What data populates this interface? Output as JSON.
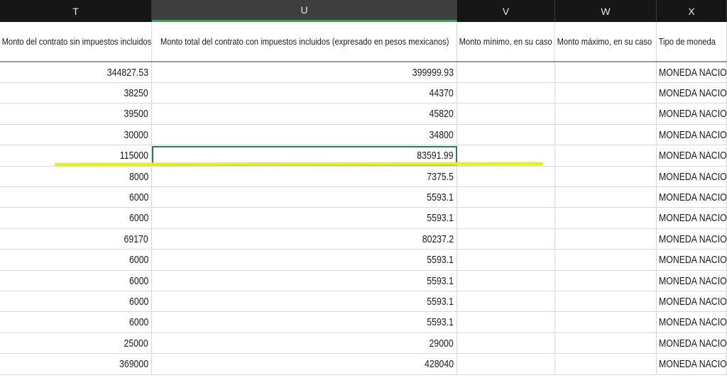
{
  "columns": [
    {
      "letter": "T",
      "header": "Monto del contrato sin impuestos incluidos"
    },
    {
      "letter": "U",
      "header": "Monto total del contrato con impuestos incluidos (expresado en pesos mexicanos)"
    },
    {
      "letter": "V",
      "header": "Monto mínimo, en su caso"
    },
    {
      "letter": "W",
      "header": "Monto máximo, en su caso"
    },
    {
      "letter": "X",
      "header": "Tipo de moneda"
    }
  ],
  "selected_column": "U",
  "rows": [
    [
      "344827.53",
      "399999.93",
      "",
      "",
      "MONEDA NACIOI"
    ],
    [
      "38250",
      "44370",
      "",
      "",
      "MONEDA NACIOI"
    ],
    [
      "39500",
      "45820",
      "",
      "",
      "MONEDA NACIOI"
    ],
    [
      "30000",
      "34800",
      "",
      "",
      "MONEDA NACIOI"
    ],
    [
      "115000",
      "83591.99",
      "",
      "",
      "MONEDA NACIOI"
    ],
    [
      "8000",
      "7375.5",
      "",
      "",
      "MONEDA NACIOI"
    ],
    [
      "6000",
      "5593.1",
      "",
      "",
      "MONEDA NACIOI"
    ],
    [
      "6000",
      "5593.1",
      "",
      "",
      "MONEDA NACIOI"
    ],
    [
      "69170",
      "80237.2",
      "",
      "",
      "MONEDA NACIOI"
    ],
    [
      "6000",
      "5593.1",
      "",
      "",
      "MONEDA NACIOI"
    ],
    [
      "6000",
      "5593.1",
      "",
      "",
      "MONEDA NACIOI"
    ],
    [
      "6000",
      "5593.1",
      "",
      "",
      "MONEDA NACIOI"
    ],
    [
      "6000",
      "5593.1",
      "",
      "",
      "MONEDA NACIOI"
    ],
    [
      "25000",
      "29000",
      "",
      "",
      "MONEDA NACIOI"
    ],
    [
      "369000",
      "428040",
      "",
      "",
      "MONEDA NACIOI"
    ]
  ],
  "active_row_index": 4,
  "highlight_color": "#e4ef1a",
  "selection_color": "#2f7d48"
}
